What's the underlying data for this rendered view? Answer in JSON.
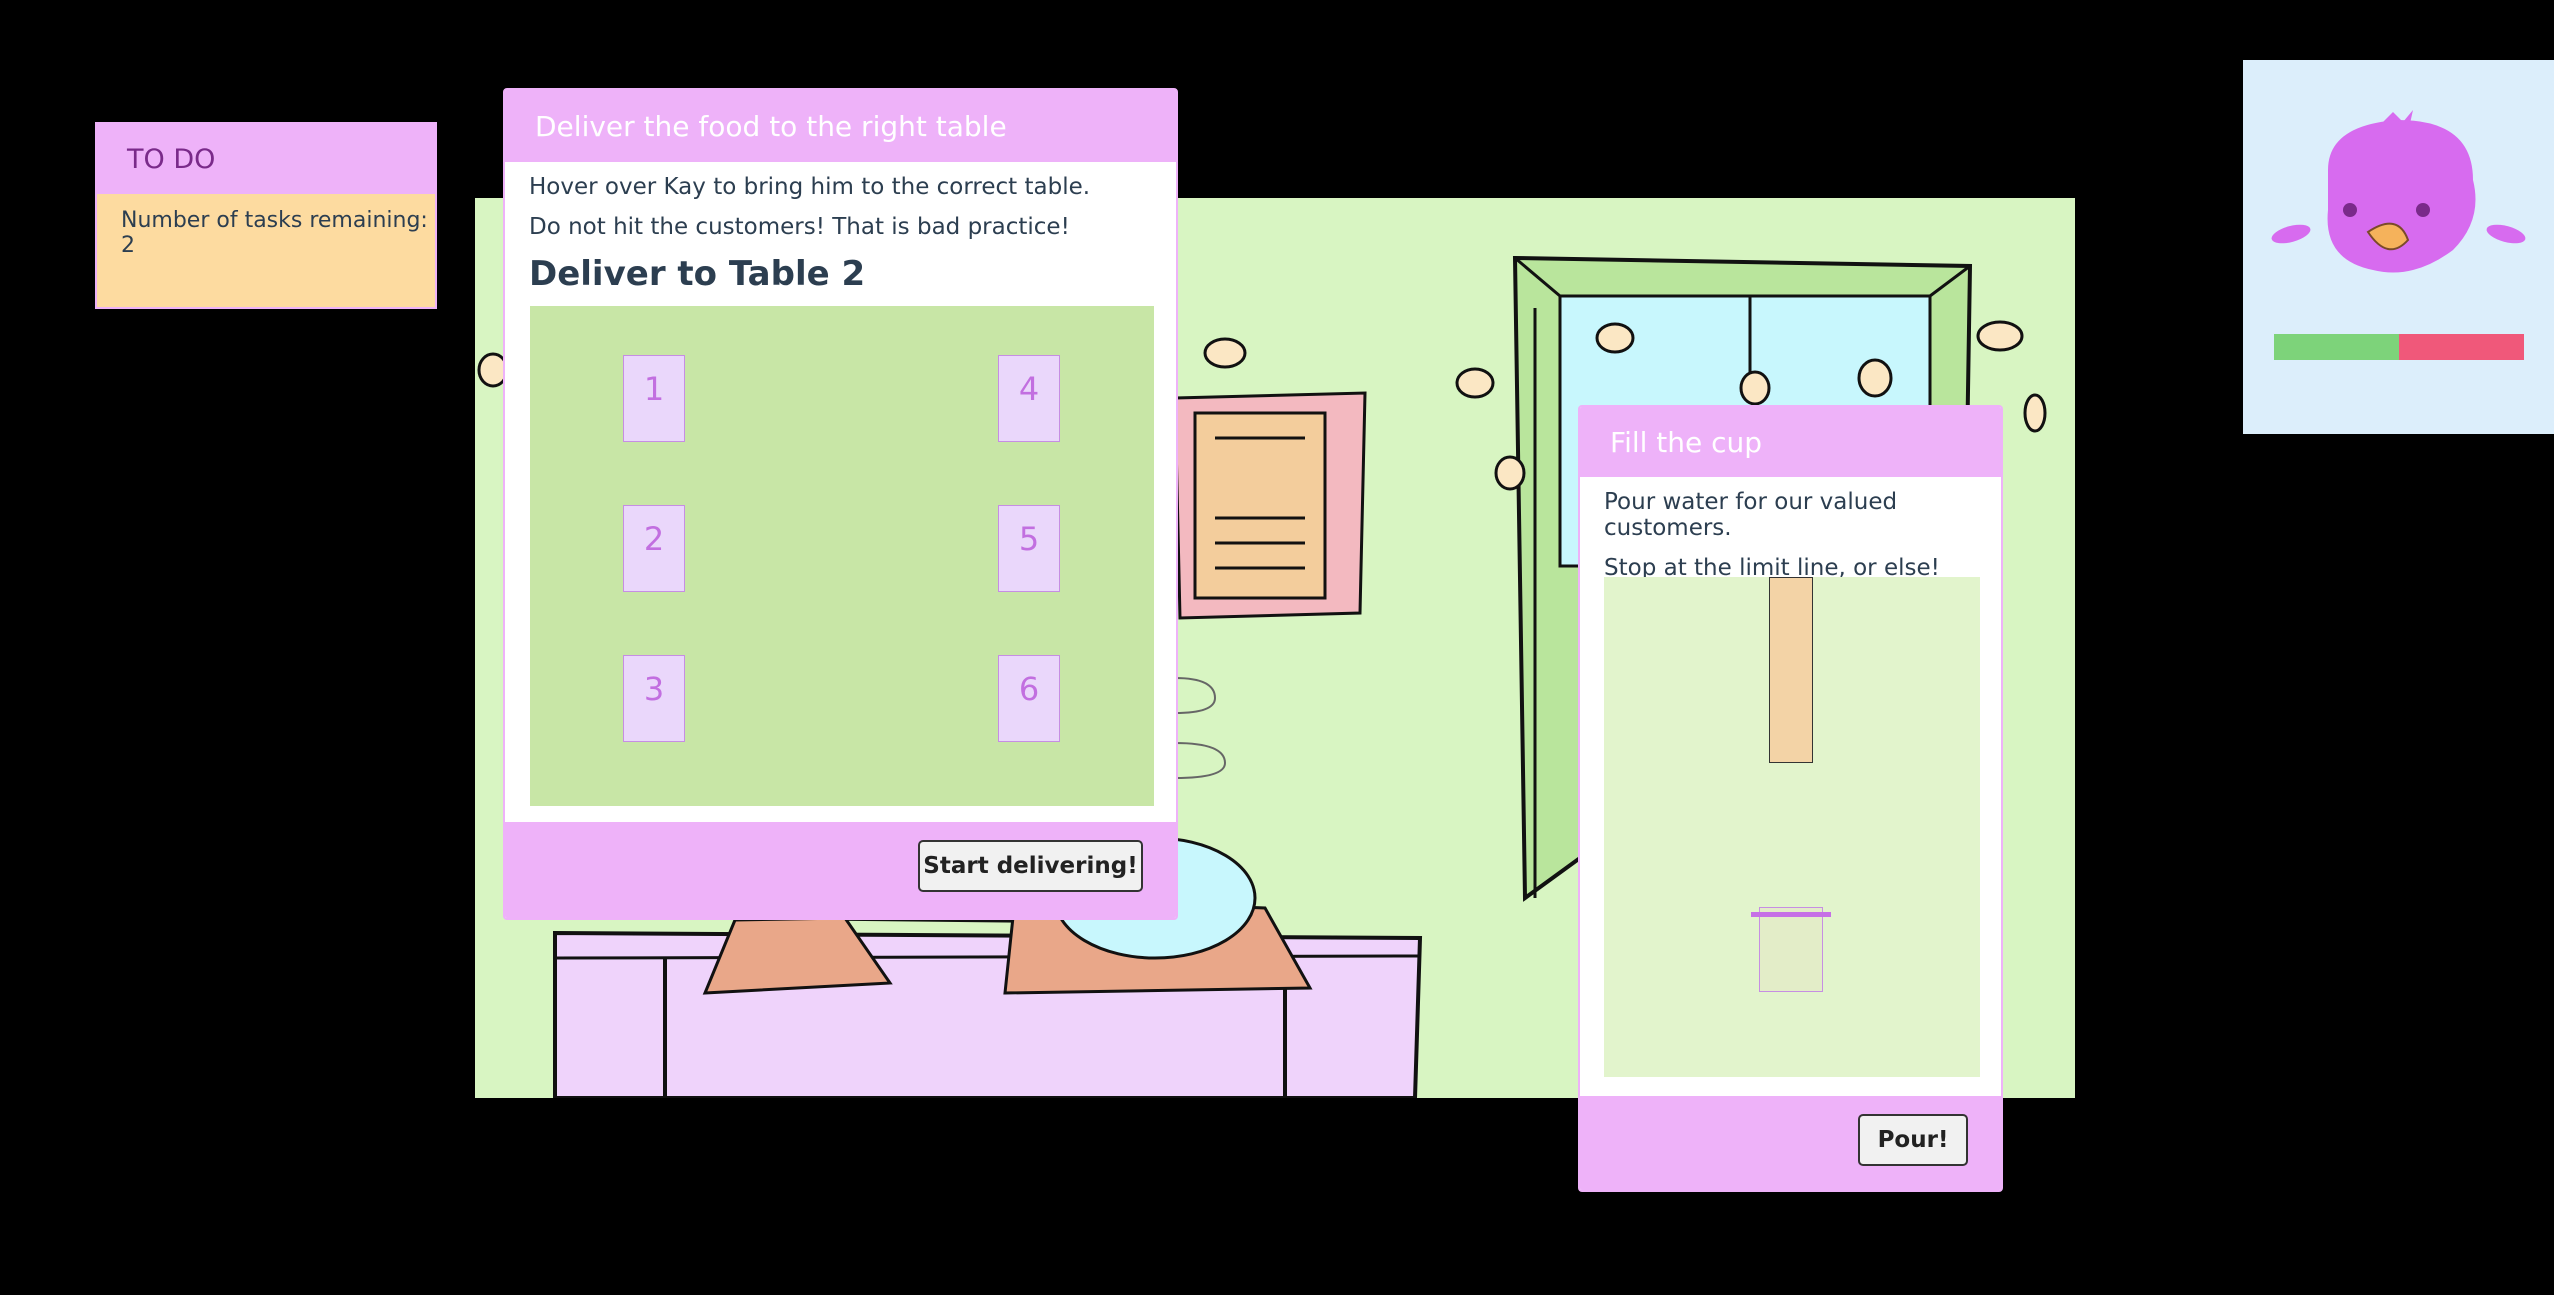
{
  "todo": {
    "title": "TO DO",
    "tasks_text": "Number of tasks remaining: 2"
  },
  "deliver": {
    "title": "Deliver the food to the right table",
    "instruction_1": "Hover over Kay to bring him to the correct table.",
    "instruction_2": "Do not hit the customers! That is bad practice!",
    "target_heading": "Deliver to Table 2",
    "tables": [
      "1",
      "2",
      "3",
      "4",
      "5",
      "6"
    ],
    "start_button": "Start delivering!"
  },
  "cup": {
    "title": "Fill the cup",
    "instruction_1": "Pour water for our valued customers.",
    "instruction_2": "Stop at the limit line, or else!",
    "pour_button": "Pour!"
  },
  "status": {
    "health_fraction": 0.5,
    "good_color": "#7dd37a",
    "bad_color": "#f0587a"
  },
  "colors": {
    "accent": "#eeb2f9",
    "scene_bg": "#d8f5c2",
    "map_bg": "#c8e6a6"
  }
}
